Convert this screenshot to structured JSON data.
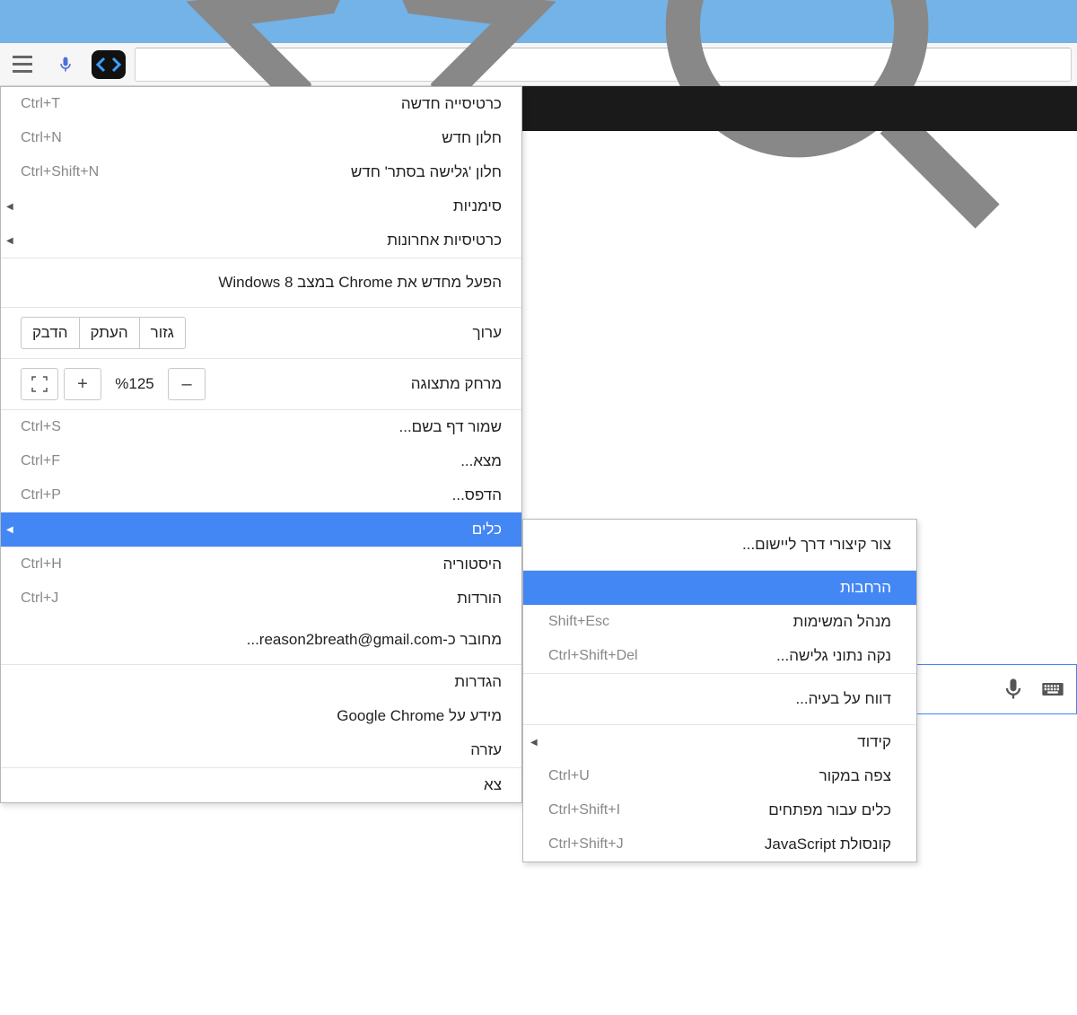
{
  "menu": {
    "new_tab": {
      "label": "כרטיסייה חדשה",
      "shortcut": "Ctrl+T"
    },
    "new_window": {
      "label": "חלון חדש",
      "shortcut": "Ctrl+N"
    },
    "incognito": {
      "label": "חלון 'גלישה בסתר' חדש",
      "shortcut": "Ctrl+Shift+N"
    },
    "bookmarks": {
      "label": "סימניות"
    },
    "recent_tabs": {
      "label": "כרטיסיות אחרונות"
    },
    "relaunch_win8": {
      "label": "הפעל מחדש את Chrome במצב Windows 8"
    },
    "edit": {
      "label": "ערוך",
      "cut": "גזור",
      "copy": "העתק",
      "paste": "הדבק"
    },
    "zoom": {
      "label": "מרחק מתצוגה",
      "value": "%125",
      "minus": "–",
      "plus": "+"
    },
    "save_as": {
      "label": "שמור דף בשם...",
      "shortcut": "Ctrl+S"
    },
    "find": {
      "label": "מצא...",
      "shortcut": "Ctrl+F"
    },
    "print": {
      "label": "הדפס...",
      "shortcut": "Ctrl+P"
    },
    "tools": {
      "label": "כלים"
    },
    "history": {
      "label": "היסטוריה",
      "shortcut": "Ctrl+H"
    },
    "downloads": {
      "label": "הורדות",
      "shortcut": "Ctrl+J"
    },
    "signed_in": {
      "label": "מחובר כ-reason2breath@gmail.com..."
    },
    "settings": {
      "label": "הגדרות"
    },
    "about": {
      "label": "מידע על Google Chrome"
    },
    "help": {
      "label": "עזרה"
    },
    "exit": {
      "label": "צא"
    }
  },
  "tools_submenu": {
    "create_shortcut": {
      "label": "צור קיצורי דרך ליישום..."
    },
    "extensions": {
      "label": "הרחבות"
    },
    "task_manager": {
      "label": "מנהל המשימות",
      "shortcut": "Shift+Esc"
    },
    "clear_data": {
      "label": "נקה נתוני גלישה...",
      "shortcut": "Ctrl+Shift+Del"
    },
    "report_issue": {
      "label": "דווח על בעיה..."
    },
    "encoding": {
      "label": "קידוד"
    },
    "view_source": {
      "label": "צפה במקור",
      "shortcut": "Ctrl+U"
    },
    "dev_tools": {
      "label": "כלים עבור מפתחים",
      "shortcut": "Ctrl+Shift+I"
    },
    "js_console": {
      "label": "קונסולת JavaScript",
      "shortcut": "Ctrl+Shift+J"
    }
  }
}
